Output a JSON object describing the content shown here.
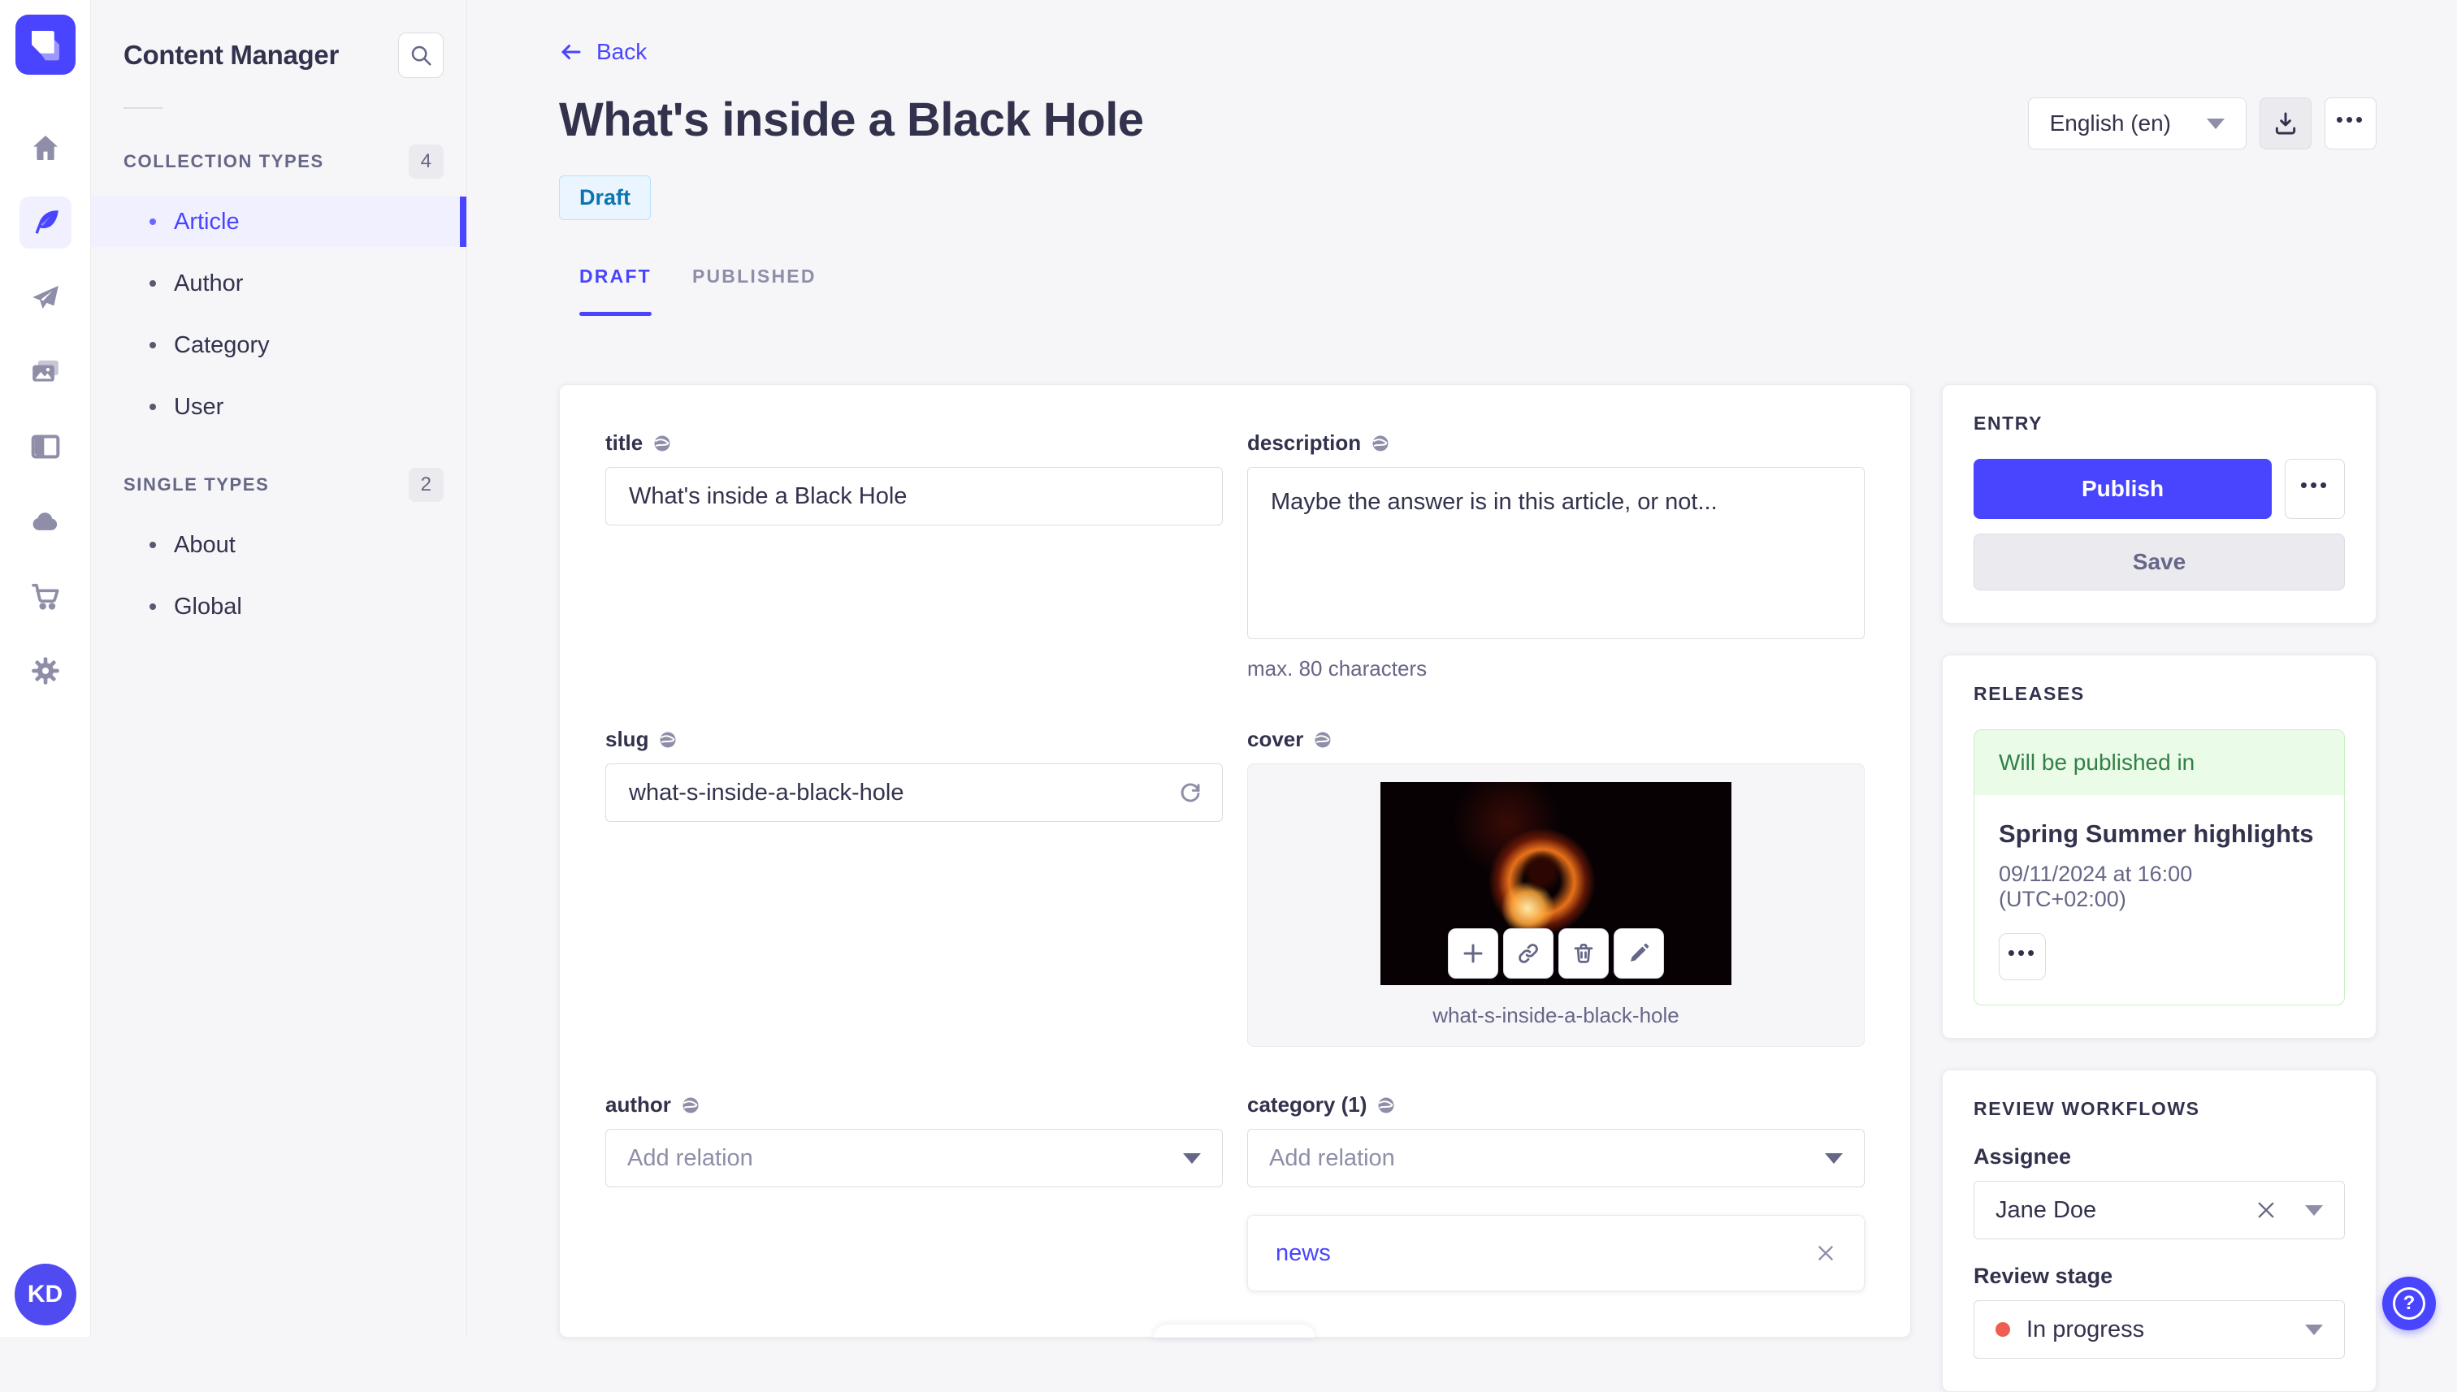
{
  "colors": {
    "accent": "#4945ff",
    "active_bg": "#f0f0ff",
    "draft_bg": "#eaf5ff",
    "draft_text": "#0c75af",
    "release_green_bg": "#eafbe7",
    "release_green_text": "#328048",
    "stage_dot_red": "#ee5e52",
    "page_bg": "#f6f6f9"
  },
  "icon_rail": {
    "items": [
      "home",
      "content-manager",
      "releases",
      "media-library",
      "content-type-builder",
      "deploy",
      "marketplace",
      "settings"
    ],
    "avatar": "KD"
  },
  "subnav": {
    "title": "Content Manager",
    "sections": [
      {
        "label": "COLLECTION TYPES",
        "count": "4",
        "items": [
          {
            "label": "Article"
          },
          {
            "label": "Author"
          },
          {
            "label": "Category"
          },
          {
            "label": "User"
          }
        ]
      },
      {
        "label": "SINGLE TYPES",
        "count": "2",
        "items": [
          {
            "label": "About"
          },
          {
            "label": "Global"
          }
        ]
      }
    ]
  },
  "header": {
    "back_label": "Back",
    "title": "What's inside a Black Hole",
    "status": "Draft",
    "locale": "English (en)",
    "more_label": "•••"
  },
  "tabs": {
    "draft": "DRAFT",
    "published": "PUBLISHED"
  },
  "form": {
    "title": {
      "label": "title",
      "value": "What's inside a Black Hole"
    },
    "description": {
      "label": "description",
      "value": "Maybe the answer is in this article, or not...",
      "hint": "max. 80 characters"
    },
    "slug": {
      "label": "slug",
      "value": "what-s-inside-a-black-hole"
    },
    "cover": {
      "label": "cover",
      "caption": "what-s-inside-a-black-hole"
    },
    "author": {
      "label": "author",
      "placeholder": "Add relation"
    },
    "category": {
      "label": "category (1)",
      "placeholder": "Add relation",
      "relation": "news"
    }
  },
  "entry_panel": {
    "label": "ENTRY",
    "publish": "Publish",
    "save": "Save",
    "more_label": "•••"
  },
  "releases_panel": {
    "label": "RELEASES",
    "status": "Will be published in",
    "release_name": "Spring Summer highlights",
    "release_date": "09/11/2024 at 16:00 (UTC+02:00)",
    "more_label": "•••"
  },
  "review_panel": {
    "label": "REVIEW WORKFLOWS",
    "assignee_label": "Assignee",
    "assignee_value": "Jane Doe",
    "stage_label": "Review stage",
    "stage_value": "In progress"
  },
  "help": {
    "label": "?"
  }
}
